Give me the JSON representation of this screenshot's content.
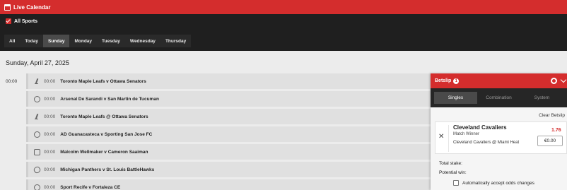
{
  "header": {
    "title": "Live Calendar"
  },
  "filters": {
    "all_sports_label": "All Sports",
    "day_tabs": [
      {
        "label": "All"
      },
      {
        "label": "Today"
      },
      {
        "label": "Sunday",
        "active": true
      },
      {
        "label": "Monday"
      },
      {
        "label": "Tuesday"
      },
      {
        "label": "Wednesday"
      },
      {
        "label": "Thursday"
      }
    ]
  },
  "schedule": {
    "date_heading": "Sunday, April 27, 2025",
    "time_group": "00:00",
    "events": [
      {
        "icon": "hockey-icon",
        "time": "00:00",
        "name": "Toronto Maple Leafs v Ottawa Senators"
      },
      {
        "icon": "soccer-ball-icon",
        "time": "00:00",
        "name": "Arsenal De Sarandi v San Martin de Tucuman"
      },
      {
        "icon": "hockey-icon",
        "time": "00:00",
        "name": "Toronto Maple Leafs @ Ottawa Senators"
      },
      {
        "icon": "soccer-ball-icon",
        "time": "00:00",
        "name": "AD Guanacasteca v Sporting San Jose FC"
      },
      {
        "icon": "boxing-glove-icon",
        "time": "00:00",
        "name": "Malcolm Wellmaker v Cameron Saaiman"
      },
      {
        "icon": "american-football-icon",
        "time": "00:00",
        "name": "Michigan Panthers v St. Louis BattleHawks"
      },
      {
        "icon": "soccer-ball-icon",
        "time": "00:00",
        "name": "Sport Recife v Fortaleza CE"
      }
    ]
  },
  "betslip": {
    "title": "Betslip",
    "count": "1",
    "tabs": [
      {
        "label": "Singles",
        "active": true
      },
      {
        "label": "Combination"
      },
      {
        "label": "System"
      }
    ],
    "clear_label": "Clear Betslip",
    "selection": {
      "team": "Cleveland Cavaliers",
      "market": "Match Winner",
      "event": "Cleveland Cavaliers @ Miami Heat",
      "odds": "1.76",
      "stake_value": "€0.00"
    },
    "total_stake_label": "Total stake:",
    "potential_win_label": "Potential win:",
    "accept_odds_label": "Automatically accept odds changes"
  },
  "colors": {
    "brand_red": "#d42d2d",
    "dark_bg": "#1f1f1f"
  }
}
